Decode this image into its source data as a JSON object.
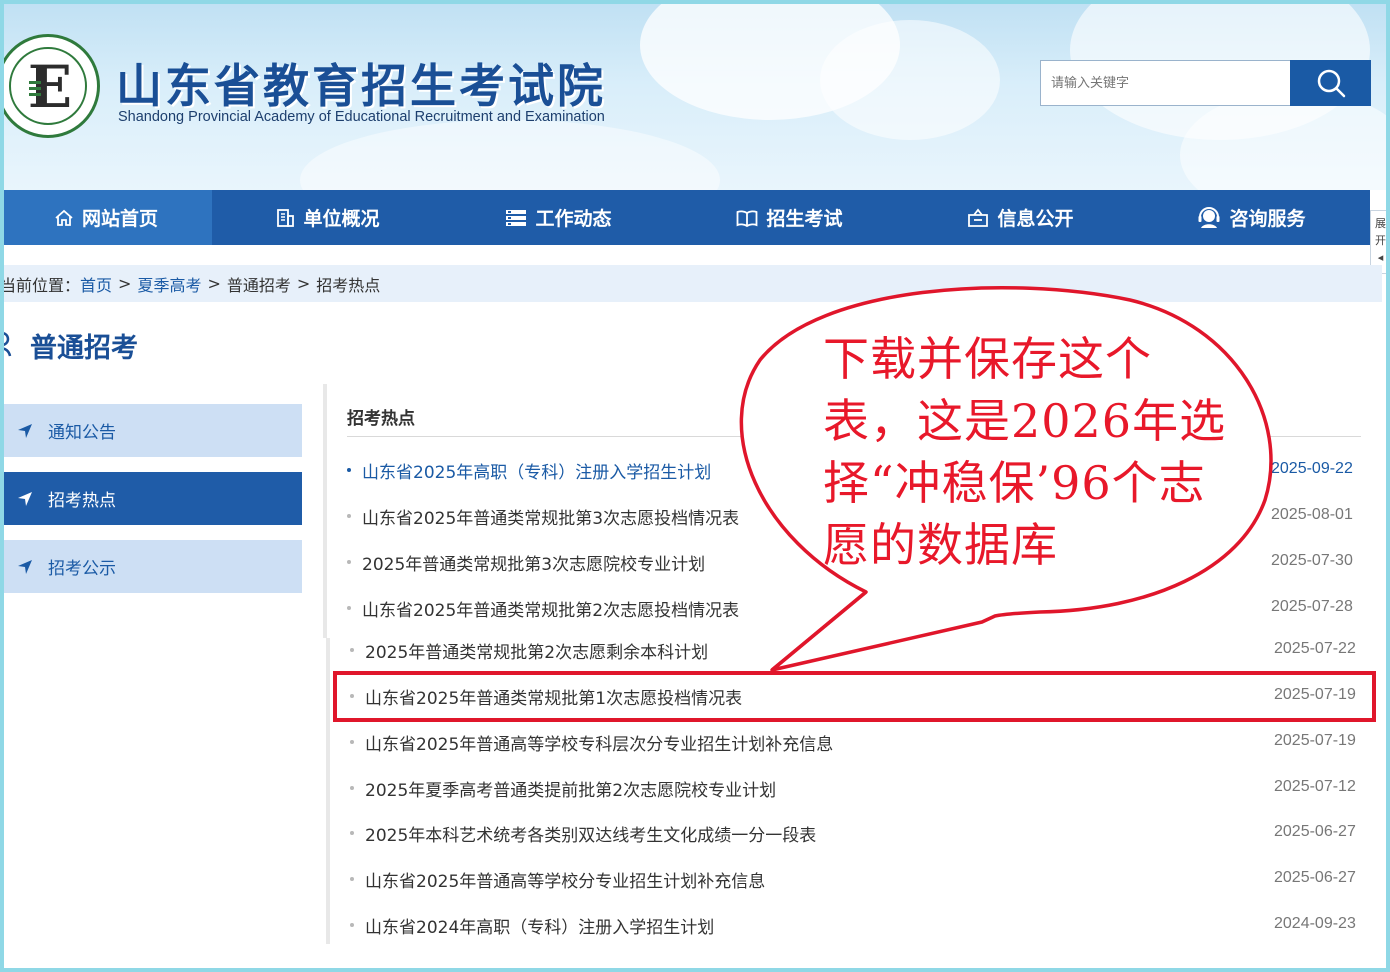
{
  "header": {
    "title": "山东省教育招生考试院",
    "subtitle": "Shandong Provincial Academy of Educational Recruitment and Examination",
    "logo_letter": "E",
    "search_placeholder": "请输入关键字"
  },
  "nav": {
    "items": [
      {
        "label": "网站首页",
        "icon": "home-icon"
      },
      {
        "label": "单位概况",
        "icon": "building-icon"
      },
      {
        "label": "工作动态",
        "icon": "list-icon"
      },
      {
        "label": "招生考试",
        "icon": "book-icon"
      },
      {
        "label": "信息公开",
        "icon": "info-box-icon"
      },
      {
        "label": "咨询服务",
        "icon": "headset-icon"
      }
    ]
  },
  "side_tab": {
    "line1": "展",
    "line2": "开"
  },
  "breadcrumb": {
    "prefix": "当前位置：",
    "items": [
      "首页",
      "夏季高考",
      "普通招考",
      "招考热点"
    ]
  },
  "section": {
    "title": "普通招考"
  },
  "sidebar": {
    "items": [
      {
        "label": "通知公告"
      },
      {
        "label": "招考热点"
      },
      {
        "label": "招考公示"
      }
    ]
  },
  "content": {
    "header": "招考热点",
    "rows": [
      {
        "title": "山东省2025年高职（专科）注册入学招生计划",
        "date": "2025-09-22"
      },
      {
        "title": "山东省2025年普通类常规批第3次志愿投档情况表",
        "date": "2025-08-01"
      },
      {
        "title": "2025年普通类常规批第3次志愿院校专业计划",
        "date": "2025-07-30"
      },
      {
        "title": "山东省2025年普通类常规批第2次志愿投档情况表",
        "date": "2025-07-28"
      },
      {
        "title": "2025年普通类常规批第2次志愿剩余本科计划",
        "date": "2025-07-22"
      },
      {
        "title": "山东省2025年普通类常规批第1次志愿投档情况表",
        "date": "2025-07-19"
      },
      {
        "title": "山东省2025年普通高等学校专科层次分专业招生计划补充信息",
        "date": "2025-07-19"
      },
      {
        "title": "2025年夏季高考普通类提前批第2次志愿院校专业计划",
        "date": "2025-07-12"
      },
      {
        "title": "2025年本科艺术统考各类别双达线考生文化成绩一分一段表",
        "date": "2025-06-27"
      },
      {
        "title": "山东省2025年普通高等学校分专业招生计划补充信息",
        "date": "2025-06-27"
      },
      {
        "title": "山东省2024年高职（专科）注册入学招生计划",
        "date": "2024-09-23"
      }
    ]
  },
  "annotation": {
    "lines": [
      "下载并保存这个",
      "表，这是2026年选",
      "择“冲稳保’96个志",
      "愿的数据库"
    ]
  },
  "colors": {
    "brand_blue": "#1f5ca8",
    "annotation_red": "#e0162b"
  }
}
